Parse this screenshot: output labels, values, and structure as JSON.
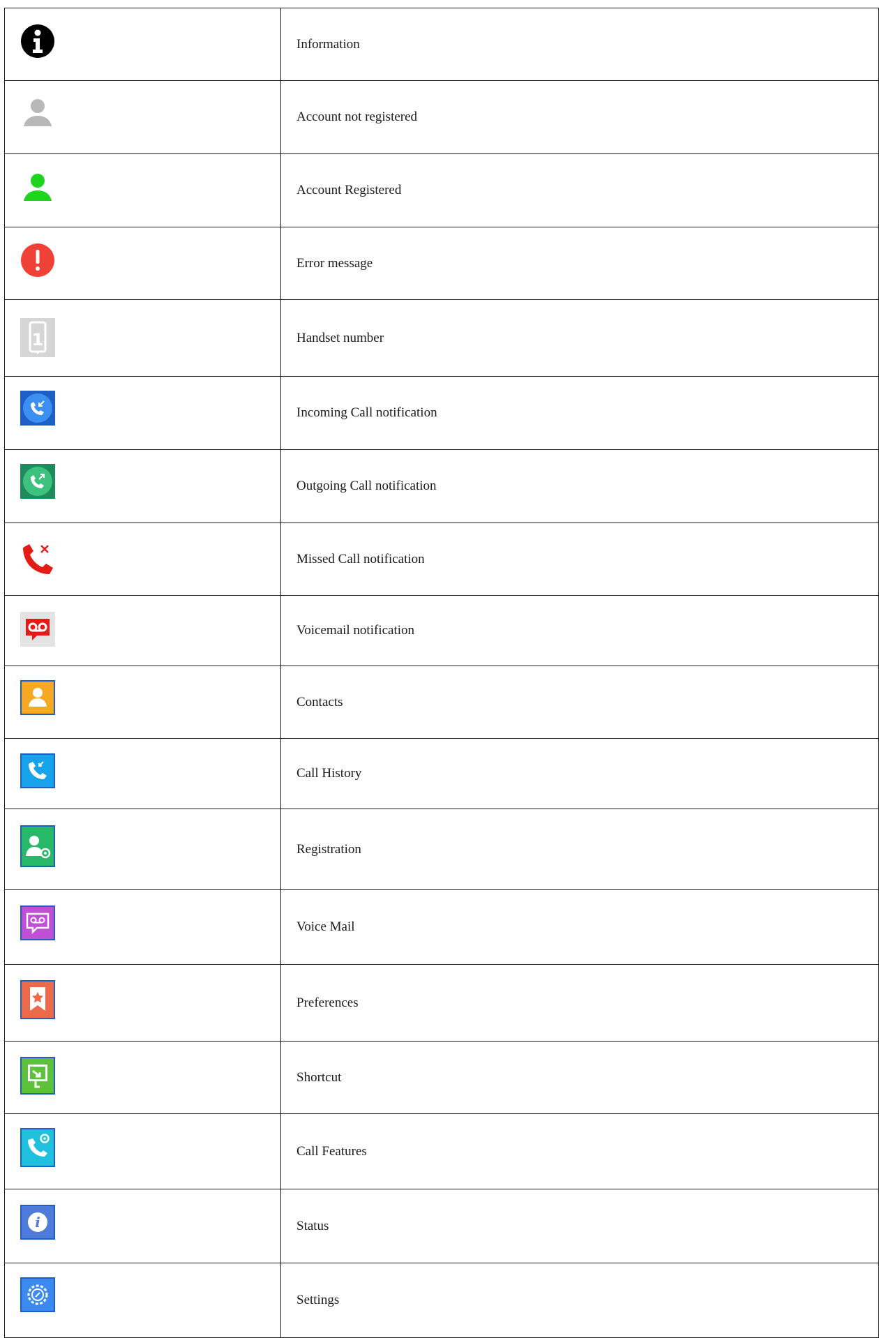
{
  "rows": [
    {
      "icon": "info-circle-icon",
      "label": "Information"
    },
    {
      "icon": "account-not-registered-icon",
      "label": "Account not registered"
    },
    {
      "icon": "account-registered-icon",
      "label": "Account Registered"
    },
    {
      "icon": "error-message-icon",
      "label": "Error message"
    },
    {
      "icon": "handset-number-icon",
      "label": "Handset number"
    },
    {
      "icon": "incoming-call-icon",
      "label": "Incoming Call notification"
    },
    {
      "icon": "outgoing-call-icon",
      "label": "Outgoing Call notification"
    },
    {
      "icon": "missed-call-icon",
      "label": "Missed Call notification"
    },
    {
      "icon": "voicemail-notification-icon",
      "label": "Voicemail notification"
    },
    {
      "icon": "contacts-icon",
      "label": "Contacts"
    },
    {
      "icon": "call-history-icon",
      "label": "Call History"
    },
    {
      "icon": "registration-icon",
      "label": "Registration"
    },
    {
      "icon": "voice-mail-icon",
      "label": "Voice Mail"
    },
    {
      "icon": "preferences-icon",
      "label": "Preferences"
    },
    {
      "icon": "shortcut-icon",
      "label": "Shortcut"
    },
    {
      "icon": "call-features-icon",
      "label": "Call Features"
    },
    {
      "icon": "status-icon",
      "label": "Status"
    },
    {
      "icon": "settings-icon",
      "label": "Settings"
    }
  ],
  "colors": {
    "border": "#1a1a1a",
    "registered_green": "#1ed51e",
    "unregistered_gray": "#b8b8b8",
    "error_red": "#ef4136",
    "missed_red": "#e41b17"
  }
}
